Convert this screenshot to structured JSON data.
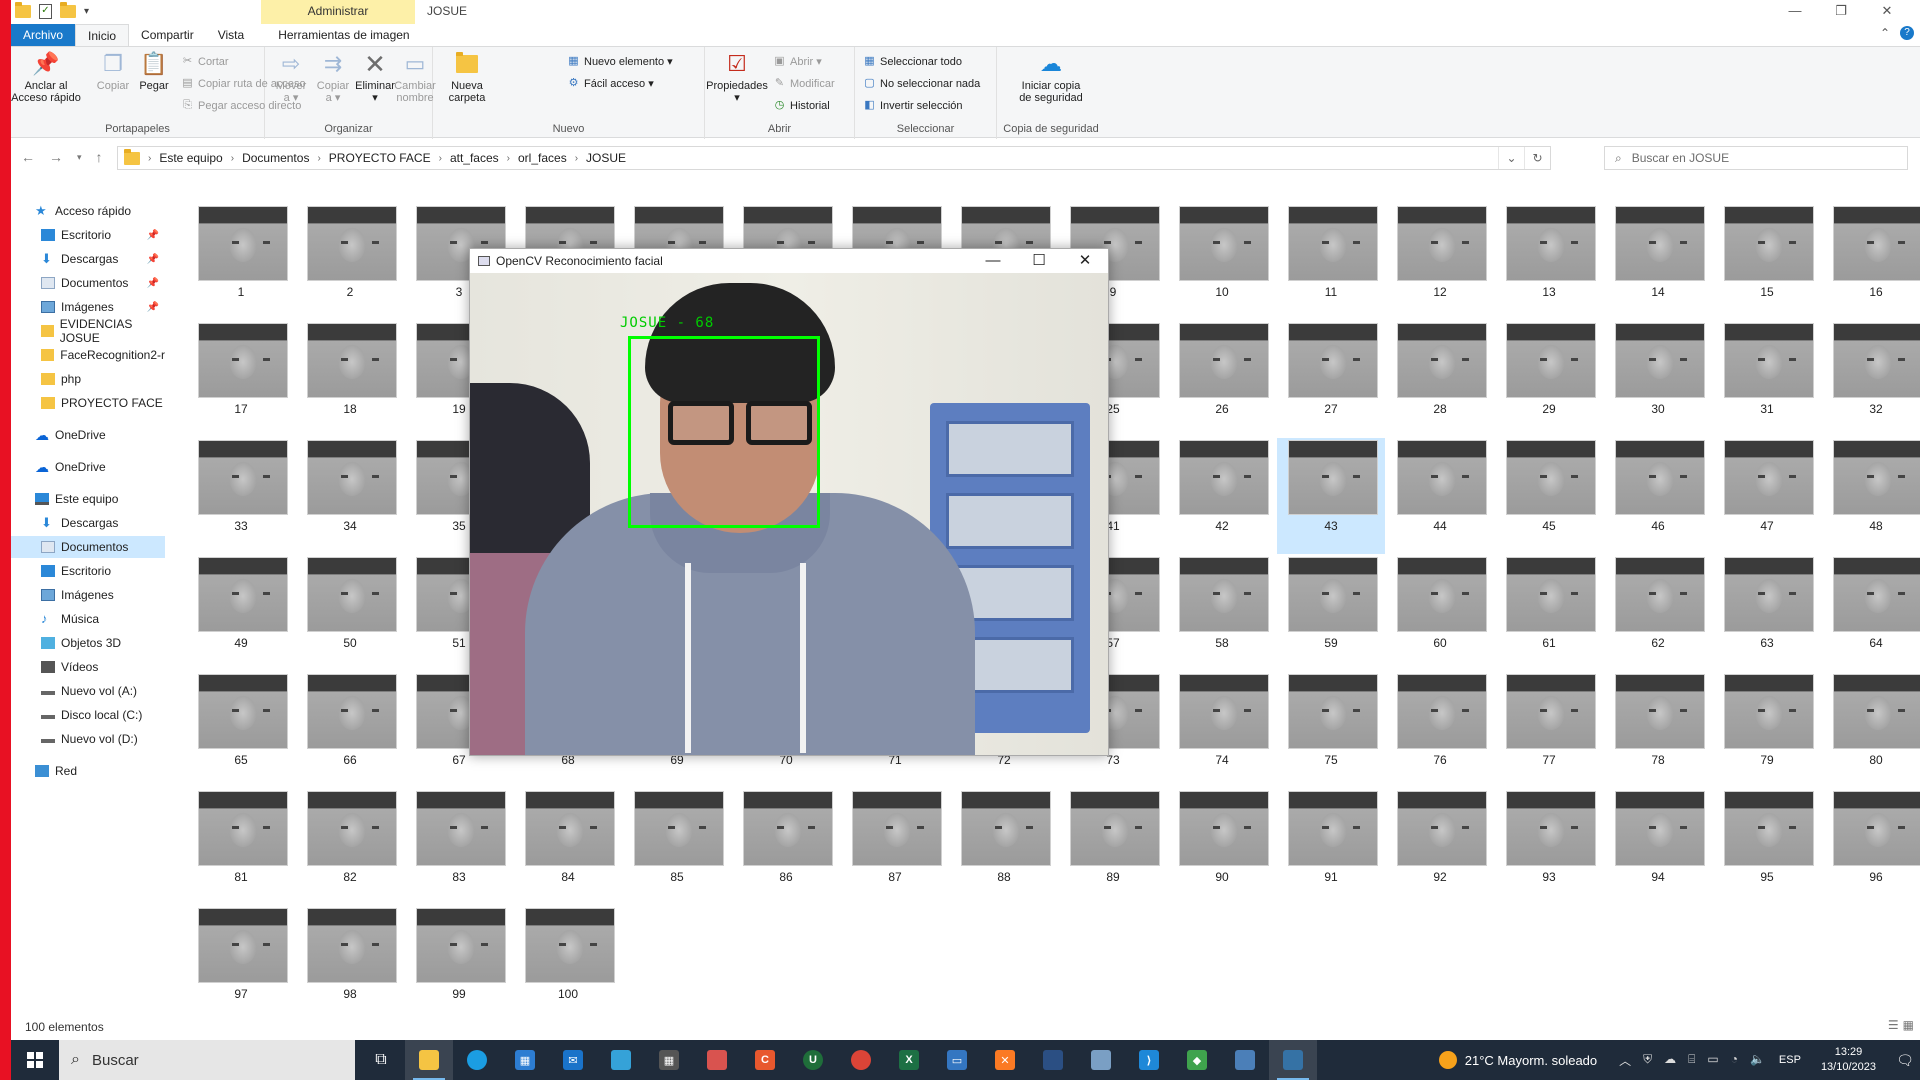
{
  "titlebar": {
    "admin_tab": "Administrar",
    "title": "JOSUE",
    "controls": [
      "—",
      "❐",
      "✕"
    ]
  },
  "ribbon_tabs": [
    "Archivo",
    "Inicio",
    "Compartir",
    "Vista",
    "Herramientas de imagen"
  ],
  "ribbon": {
    "portapapeles": {
      "label": "Portapapeles",
      "pin": "Anclar al\nAcceso rápido",
      "copy": "Copiar",
      "paste": "Pegar",
      "cut": "Cortar",
      "copy_path": "Copiar ruta de acceso",
      "paste_shortcut": "Pegar acceso directo"
    },
    "organizar": {
      "label": "Organizar",
      "move": "Mover\na ▾",
      "copy_to": "Copiar\na ▾",
      "delete": "Eliminar\n▾",
      "rename": "Cambiar\nnombre"
    },
    "nuevo": {
      "label": "Nuevo",
      "new_folder": "Nueva\ncarpeta",
      "new_item": "Nuevo elemento ▾",
      "easy_access": "Fácil acceso ▾"
    },
    "abrir": {
      "label": "Abrir",
      "properties": "Propiedades\n▾",
      "open": "Abrir ▾",
      "edit": "Modificar",
      "history": "Historial"
    },
    "seleccionar": {
      "label": "Seleccionar",
      "select_all": "Seleccionar todo",
      "select_none": "No seleccionar nada",
      "invert": "Invertir selección"
    },
    "backup": {
      "label": "Copia de seguridad",
      "start": "Iniciar copia\nde seguridad"
    }
  },
  "address": {
    "crumbs": [
      "Este equipo",
      "Documentos",
      "PROYECTO FACE",
      "att_faces",
      "orl_faces",
      "JOSUE"
    ],
    "search_placeholder": "Buscar en JOSUE"
  },
  "nav": {
    "quick_access": "Acceso rápido",
    "items": [
      {
        "label": "Escritorio",
        "pinned": true
      },
      {
        "label": "Descargas",
        "pinned": true
      },
      {
        "label": "Documentos",
        "pinned": true
      },
      {
        "label": "Imágenes",
        "pinned": true
      },
      {
        "label": "EVIDENCIAS JOSUE"
      },
      {
        "label": "FaceRecognition2-r"
      },
      {
        "label": "php"
      },
      {
        "label": "PROYECTO FACE"
      }
    ],
    "onedrive1": "OneDrive",
    "onedrive2": "OneDrive",
    "this_pc": "Este equipo",
    "pc_items": [
      "Descargas",
      "Documentos",
      "Escritorio",
      "Imágenes",
      "Música",
      "Objetos 3D",
      "Vídeos",
      "Nuevo vol (A:)",
      "Disco local (C:)",
      "Nuevo vol (D:)"
    ],
    "network": "Red"
  },
  "status": {
    "count": "100 elementos"
  },
  "files": {
    "count": 100,
    "selected": 43
  },
  "cv_window": {
    "title": "OpenCV Reconocimiento facial",
    "label": "JOSUE - 68"
  },
  "taskbar": {
    "search": "Buscar",
    "weather": "21°C  Mayorm. soleado",
    "lang": "ESP",
    "time": "13:29",
    "date": "13/10/2023"
  },
  "colors": {
    "accent": "#1979ca",
    "selection": "#cce8ff",
    "detect_box": "#00ff00",
    "taskbar": "#1f2b3a"
  }
}
